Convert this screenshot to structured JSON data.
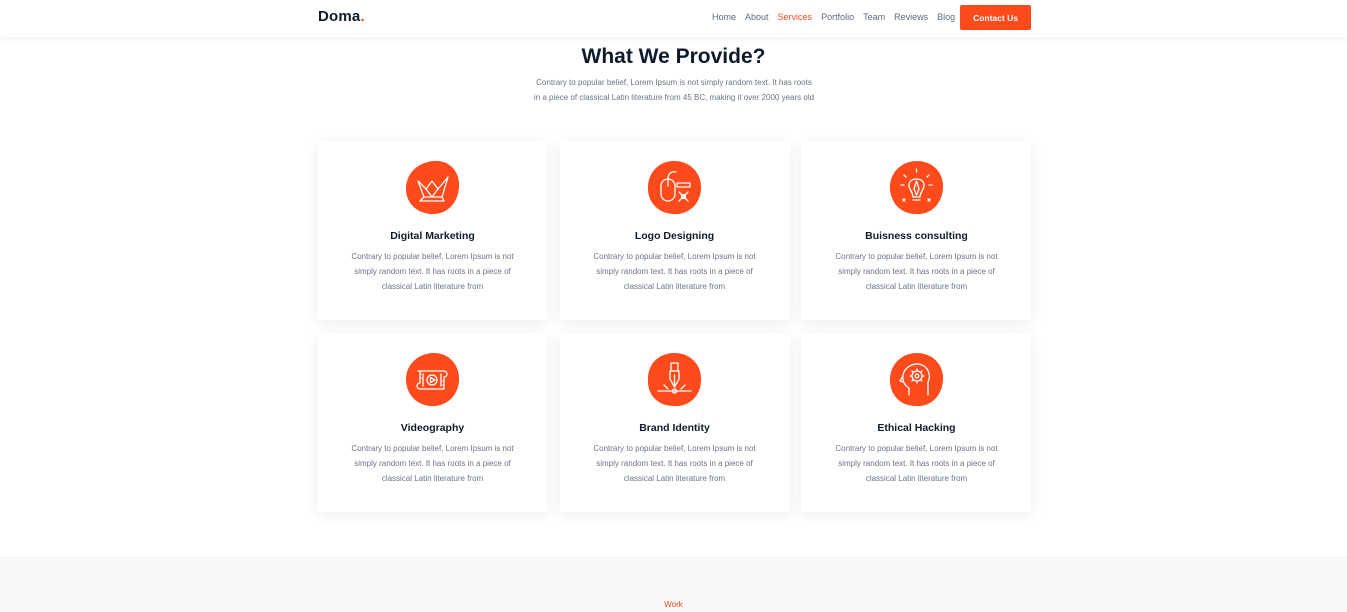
{
  "header": {
    "logo_text": "Doma",
    "logo_dot": ".",
    "nav": [
      "Home",
      "About",
      "Services",
      "Portfolio",
      "Team",
      "Reviews",
      "Blog"
    ],
    "active_nav": "Services",
    "contact_label": "Contact Us"
  },
  "section": {
    "title": "What We Provide?",
    "description": "Contrary to popular belief, Lorem Ipsum is not simply random text. It has roots in a piece of classical Latin literature from 45 BC, making it over 2000 years old"
  },
  "services": [
    {
      "title": "Digital Marketing",
      "text": "Contrary to popular belief, Lorem Ipsum is not simply random text. It has roots in a piece of classical Latin literature from",
      "icon": "origami-bird-icon"
    },
    {
      "title": "Logo Designing",
      "text": "Contrary to popular belief, Lorem Ipsum is not simply random text. It has roots in a piece of classical Latin literature from",
      "icon": "mouse-pen-icon"
    },
    {
      "title": "Buisness consulting",
      "text": "Contrary to popular belief, Lorem Ipsum is not simply random text. It has roots in a piece of classical Latin literature from",
      "icon": "lightbulb-pencil-icon"
    },
    {
      "title": "Videography",
      "text": "Contrary to popular belief, Lorem Ipsum is not simply random text. It has roots in a piece of classical Latin literature from",
      "icon": "film-play-icon"
    },
    {
      "title": "Brand Identity",
      "text": "Contrary to popular belief, Lorem Ipsum is not simply random text. It has roots in a piece of classical Latin literature from",
      "icon": "pen-nib-icon"
    },
    {
      "title": "Ethical Hacking",
      "text": "Contrary to popular belief, Lorem Ipsum is not simply random text. It has roots in a piece of classical Latin literature from",
      "icon": "head-gear-icon"
    }
  ],
  "work_section": {
    "label": "Work"
  },
  "colors": {
    "accent": "#ff4a1c",
    "heading": "#0f1b2d",
    "body_text": "#6b7584",
    "section_bg": "#f6f7f9"
  }
}
